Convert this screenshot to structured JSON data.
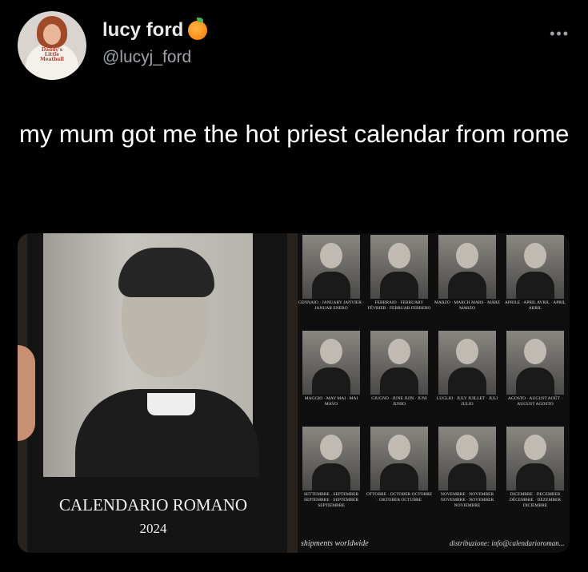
{
  "tweet": {
    "display_name": "lucy ford",
    "handle": "@lucyj_ford",
    "more_label": "•••",
    "text": "my mum got me the hot priest calendar from rome"
  },
  "avatar": {
    "shirt_text": "Daddy's Little Meatball"
  },
  "photo": {
    "cover_title": "CALENDARIO ROMANO",
    "cover_year": "2024",
    "months": [
      "GENNAIO · JANUARY JANVIER · JANUAR ENERO",
      "FEBBRAIO · FEBRUARY FÉVRIER · FEBRUAR FEBRERO",
      "MARZO · MARCH MARS · MÄRZ MARZO",
      "APRILE · APRIL AVRIL · APRIL ABRIL",
      "MAGGIO · MAY MAI · MAI MAYO",
      "GIUGNO · JUNE JUIN · JUNI JUNIO",
      "LUGLIO · JULY JUILLET · JULI JULIO",
      "AGOSTO · AUGUST AOÛT · AUGUST AGOSTO",
      "SETTEMBRE · SEPTEMBER SEPTEMBRE · SEPTEMBER SEPTIEMBRE",
      "OTTOBRE · OCTOBER OCTOBRE · OKTOBER OCTUBRE",
      "NOVEMBRE · NOVEMBER NOVEMBRE · NOVEMBER NOVIEMBRE",
      "DICEMBRE · DECEMBER DÉCEMBRE · DEZEMBER DICIEMBRE"
    ],
    "footer_left": "shipments worldwide",
    "footer_right": "distribuzione: info@calendarioroman..."
  }
}
